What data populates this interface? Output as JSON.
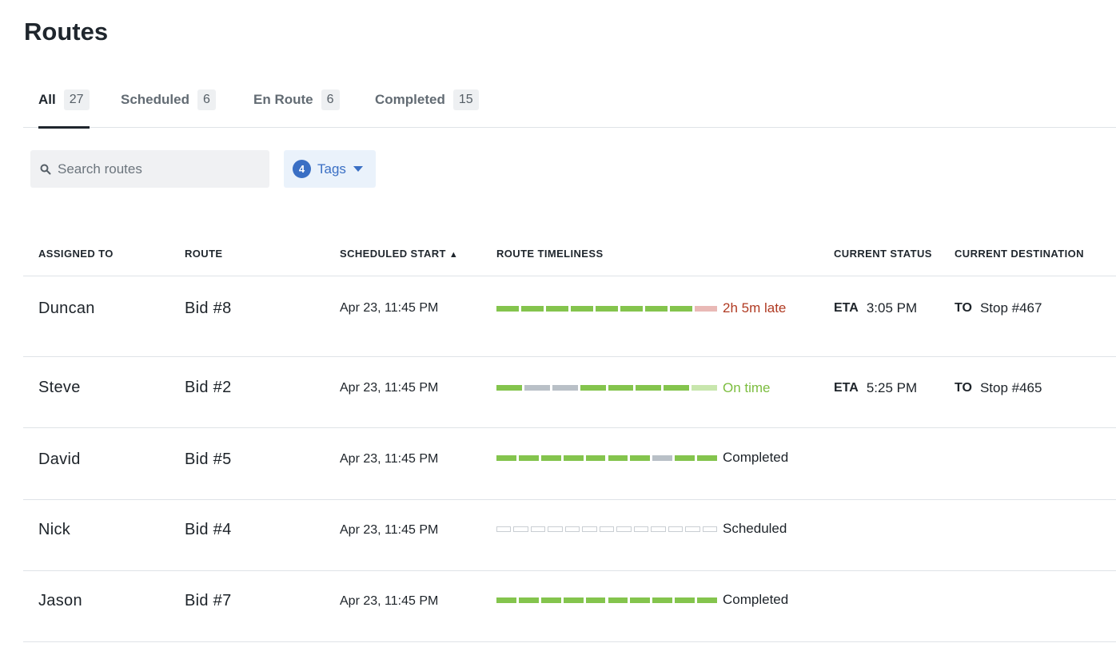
{
  "page": {
    "title": "Routes"
  },
  "tabs": [
    {
      "label": "All",
      "count": "27",
      "active": true
    },
    {
      "label": "Scheduled",
      "count": "6",
      "active": false
    },
    {
      "label": "En Route",
      "count": "6",
      "active": false
    },
    {
      "label": "Completed",
      "count": "15",
      "active": false
    }
  ],
  "search": {
    "placeholder": "Search routes",
    "value": "",
    "icon": "search-icon"
  },
  "tags_filter": {
    "count": "4",
    "label": "Tags",
    "icon": "caret-down-icon"
  },
  "table": {
    "columns": {
      "assigned_to": "ASSIGNED TO",
      "route": "ROUTE",
      "scheduled_start": "SCHEDULED START",
      "scheduled_start_sort": "▲",
      "route_timeliness": "ROUTE TIMELINESS",
      "current_status": "CURRENT STATUS",
      "current_destination": "CURRENT DESTINATION"
    },
    "status_keyword": "ETA",
    "destination_keyword": "TO",
    "colors": {
      "on_time_segment": "#84c44d",
      "pending_segment": "#b9c0c7",
      "late_segment": "#e9b9b6",
      "upcoming_segment": "#c8e6ad",
      "late_text": "#b03a22",
      "on_time_text": "#7cbd3f",
      "neutral_text": "#1d2329"
    },
    "rows": [
      {
        "assignee": "Duncan",
        "route": "Bid #8",
        "scheduled_start": "Apr 23, 11:45 PM",
        "timeline": [
          "green",
          "green",
          "green",
          "green",
          "green",
          "green",
          "green",
          "green",
          "late"
        ],
        "timeliness_label": "2h 5m late",
        "timeliness_tone": "late",
        "eta": "3:05 PM",
        "destination": "Stop #467"
      },
      {
        "assignee": "Steve",
        "route": "Bid #2",
        "scheduled_start": "Apr 23, 11:45 PM",
        "timeline": [
          "green",
          "gray",
          "gray",
          "green",
          "green",
          "green",
          "green",
          "upcoming"
        ],
        "timeliness_label": "On time",
        "timeliness_tone": "on_time",
        "eta": "5:25 PM",
        "destination": "Stop #465"
      },
      {
        "assignee": "David",
        "route": "Bid #5",
        "scheduled_start": "Apr 23, 11:45 PM",
        "timeline": [
          "green",
          "green",
          "green",
          "green",
          "green",
          "green",
          "green",
          "gray",
          "green",
          "green"
        ],
        "timeliness_label": "Completed",
        "timeliness_tone": "neutral",
        "eta": "",
        "destination": ""
      },
      {
        "assignee": "Nick",
        "route": "Bid #4",
        "scheduled_start": "Apr 23, 11:45 PM",
        "timeline": [
          "empty",
          "empty",
          "empty",
          "empty",
          "empty",
          "empty",
          "empty",
          "empty",
          "empty",
          "empty",
          "empty",
          "empty",
          "empty"
        ],
        "timeliness_label": "Scheduled",
        "timeliness_tone": "neutral",
        "eta": "",
        "destination": ""
      },
      {
        "assignee": "Jason",
        "route": "Bid #7",
        "scheduled_start": "Apr 23, 11:45 PM",
        "timeline": [
          "green",
          "green",
          "green",
          "green",
          "green",
          "green",
          "green",
          "green",
          "green",
          "green"
        ],
        "timeliness_label": "Completed",
        "timeliness_tone": "neutral",
        "eta": "",
        "destination": ""
      }
    ]
  }
}
